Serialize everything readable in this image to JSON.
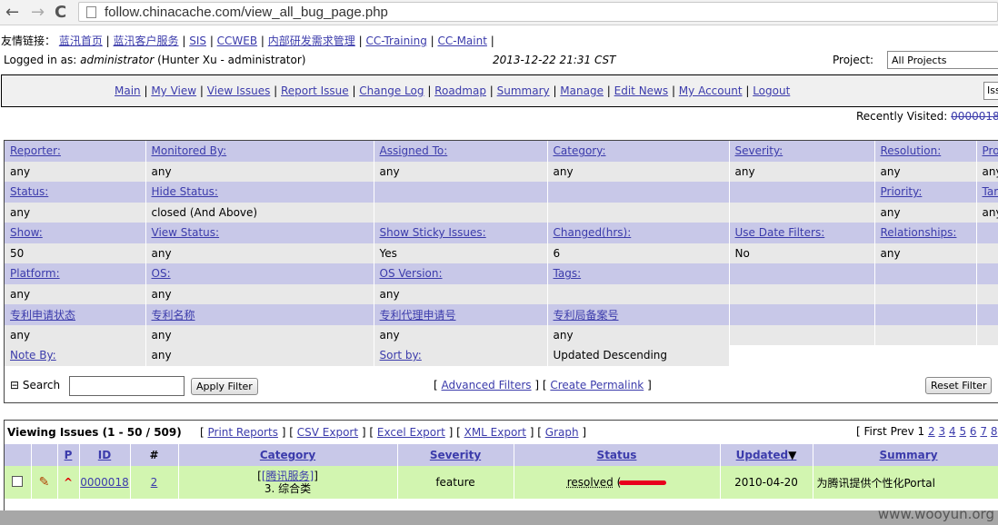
{
  "browser": {
    "url": "follow.chinacache.com/view_all_bug_page.php"
  },
  "header": {
    "links_label": "友情链接：",
    "links": [
      "蓝汛首页",
      "蓝汛客户服务",
      "SIS",
      "CCWEB",
      "内部研发需求管理",
      "CC-Training",
      "CC-Maint"
    ],
    "logged_prefix": "Logged in as: ",
    "user": "administrator",
    "user_detail": "(Hunter Xu - administrator)",
    "datetime": "2013-12-22 21:31 CST",
    "project_label": "Project:",
    "project_value": "All Projects"
  },
  "menu": {
    "items": [
      "Main",
      "My View",
      "View Issues",
      "Report Issue",
      "Change Log",
      "Roadmap",
      "Summary",
      "Manage",
      "Edit News",
      "My Account",
      "Logout"
    ],
    "jump_placeholder": "Iss"
  },
  "recent": {
    "label": "Recently Visited:",
    "value": "0000018"
  },
  "filters": {
    "rows": [
      {
        "type": "h",
        "cells": [
          "Reporter:",
          "Monitored By:",
          "Assigned To:",
          "Category:",
          "Severity:",
          "Resolution:",
          "Pro"
        ]
      },
      {
        "type": "v",
        "cells": [
          "any",
          "any",
          "any",
          "any",
          "any",
          "any",
          "any"
        ]
      },
      {
        "type": "h",
        "cells": [
          "Status:",
          "Hide Status:",
          "",
          "",
          "",
          "Priority:",
          "Tar"
        ]
      },
      {
        "type": "v",
        "cells": [
          "any",
          "closed (And Above)",
          "",
          "",
          "",
          "any",
          "any"
        ]
      },
      {
        "type": "h",
        "cells": [
          "Show:",
          "View Status:",
          "Show Sticky Issues:",
          "Changed(hrs):",
          "Use Date Filters:",
          "Relationships:",
          ""
        ]
      },
      {
        "type": "v",
        "cells": [
          "50",
          "any",
          "Yes",
          "6",
          "No",
          "any",
          ""
        ]
      },
      {
        "type": "h",
        "cells": [
          "Platform:",
          "OS:",
          "OS Version:",
          "Tags:",
          "",
          "",
          ""
        ]
      },
      {
        "type": "v",
        "cells": [
          "any",
          "any",
          "any",
          "",
          "",
          "",
          ""
        ]
      },
      {
        "type": "h",
        "cells": [
          "专利申请状态",
          "专利名称",
          "专利代理申请号",
          "专利局备案号",
          "",
          "",
          ""
        ]
      },
      {
        "type": "v",
        "cells": [
          "any",
          "any",
          "any",
          "any",
          "",
          "",
          ""
        ]
      },
      {
        "type": "v",
        "cells": [
          "Note By:",
          "any",
          "Sort by:",
          "Updated Descending",
          "",
          "",
          ""
        ]
      }
    ],
    "search_label": "⊟ Search",
    "apply_label": "Apply Filter",
    "advanced_label": "Advanced Filters",
    "permalink_label": "Create Permalink",
    "reset_label": "Reset Filter"
  },
  "list": {
    "title": "Viewing Issues (1 - 50 / 509)",
    "actions": [
      "Print Reports",
      "CSV Export",
      "Excel Export",
      "XML Export",
      "Graph"
    ],
    "paging_prefix": "[ First Prev 1",
    "pages": [
      "2",
      "3",
      "4",
      "5",
      "6",
      "7",
      "8"
    ],
    "columns": [
      "P",
      "ID",
      "#",
      "Category",
      "Severity",
      "Status",
      "Updated",
      "Summary"
    ],
    "rows": [
      {
        "id": "0000018",
        "notes": "2",
        "category_project": "[腾讯服务]",
        "category": "3. 综合类",
        "severity": "feature",
        "status": "resolved",
        "status_suffix": "(",
        "updated": "2010-04-20",
        "summary": "为腾讯提供个性化Portal"
      }
    ]
  },
  "watermark": "www.wooyun.org",
  "colors": {
    "header_row": "#c8c8e8",
    "value_row": "#e8e8e8",
    "resolved_row": "#d2f5b0",
    "link": "#3b3bab",
    "redaction": "#e8001c"
  }
}
